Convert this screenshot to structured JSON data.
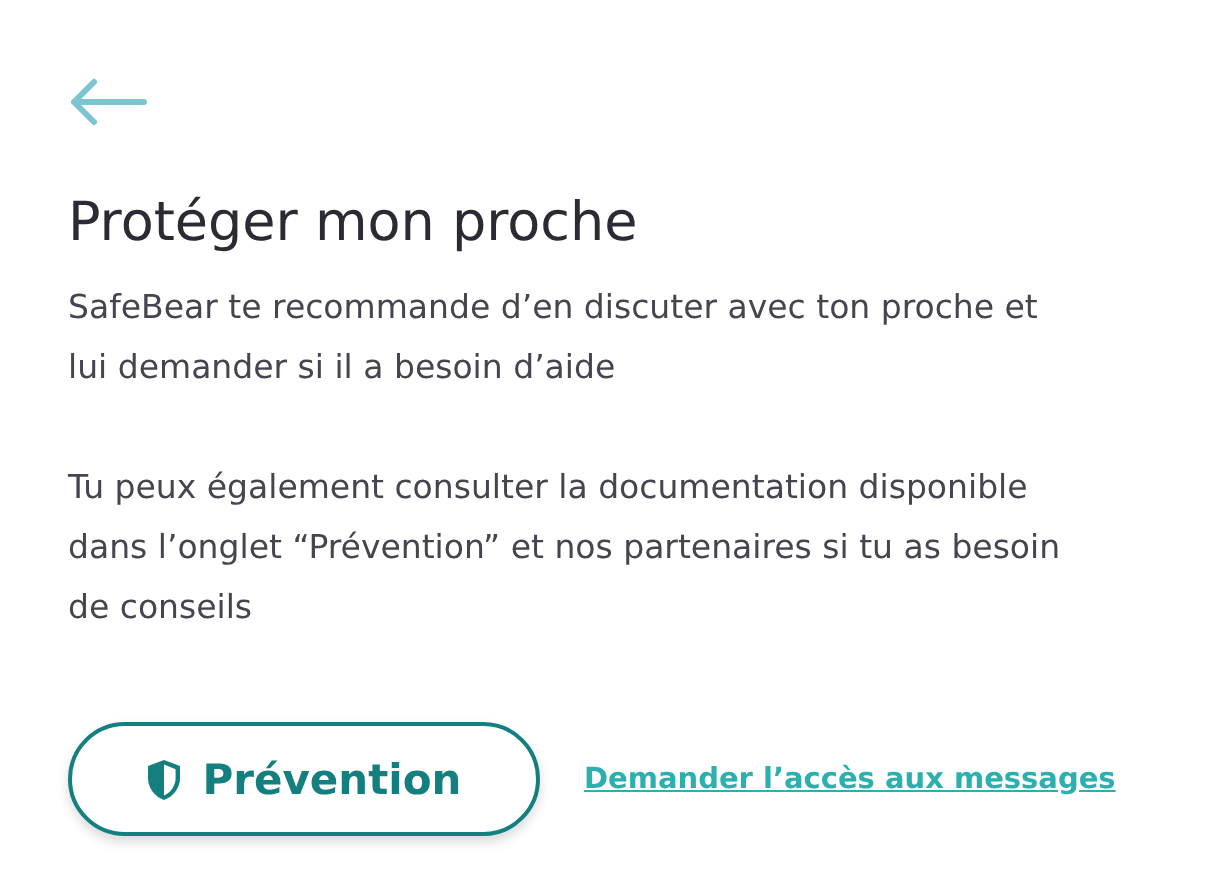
{
  "title": "Protéger mon proche",
  "paragraphs": [
    "SafeBear te recommande d’en discuter avec ton proche et lui demander si il a besoin d’aide",
    "Tu peux également consulter la documentation disponible dans l’onglet “Prévention” et nos partenaires si tu as besoin de conseils"
  ],
  "prevention_button": {
    "label": "Prévention"
  },
  "link": {
    "label": "Demander l’accès aux messages"
  }
}
